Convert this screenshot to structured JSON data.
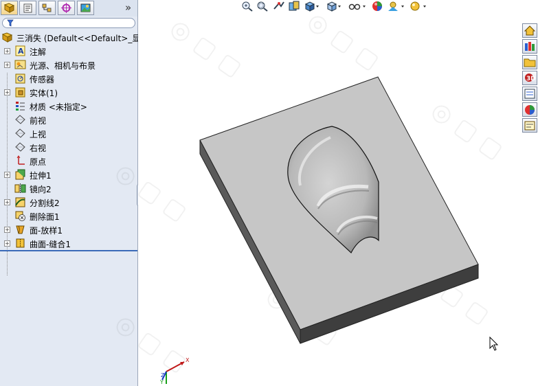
{
  "panel": {
    "tabs": [
      {
        "name": "featuremanager-tab"
      },
      {
        "name": "propertymanager-tab"
      },
      {
        "name": "configurationmanager-tab"
      },
      {
        "name": "dimxpert-tab"
      },
      {
        "name": "display-manager-tab"
      }
    ],
    "expand": "»",
    "tree": {
      "root": "三消失  (Default<<Default>_显",
      "items": [
        {
          "label": "注解",
          "icon": "annotations-icon",
          "expandable": true
        },
        {
          "label": "光源、相机与布景",
          "icon": "lights-camera-icon",
          "expandable": true
        },
        {
          "label": "传感器",
          "icon": "sensors-icon",
          "expandable": false
        },
        {
          "label": "实体(1)",
          "icon": "solid-bodies-icon",
          "expandable": true
        },
        {
          "label": "材质 <未指定>",
          "icon": "material-icon",
          "expandable": false
        },
        {
          "label": "前视",
          "icon": "plane-icon",
          "expandable": false
        },
        {
          "label": "上视",
          "icon": "plane-icon",
          "expandable": false
        },
        {
          "label": "右视",
          "icon": "plane-icon",
          "expandable": false
        },
        {
          "label": "原点",
          "icon": "origin-icon",
          "expandable": false
        },
        {
          "label": "拉伸1",
          "icon": "extrude-icon",
          "expandable": true
        },
        {
          "label": "镜向2",
          "icon": "mirror-icon",
          "expandable": false
        },
        {
          "label": "分割线2",
          "icon": "split-line-icon",
          "expandable": true
        },
        {
          "label": "删除面1",
          "icon": "delete-face-icon",
          "expandable": false
        },
        {
          "label": "面-放样1",
          "icon": "loft-surface-icon",
          "expandable": true
        },
        {
          "label": "曲面-缝合1",
          "icon": "knit-surface-icon",
          "expandable": true
        }
      ]
    }
  },
  "view_toolbar": [
    "zoom-to-fit-icon",
    "zoom-to-area-icon",
    "previous-view-icon",
    "section-view-icon",
    "view-orientation-icon",
    "display-style-icon",
    "hide-show-items-icon",
    "edit-appearance-icon",
    "apply-scene-icon",
    "view-settings-icon"
  ],
  "task_pane": [
    "resources-icon",
    "design-library-icon",
    "file-explorer-icon",
    "search-icon",
    "view-palette-icon",
    "appearances-icon",
    "custom-properties-icon"
  ],
  "triad": {
    "x": "X",
    "y": "Y",
    "z": "Z"
  },
  "colors": {
    "panel_bg": "#e3e9f3",
    "model_top": "#c6c6c6",
    "model_front": "#5a5a5a",
    "model_side": "#3e3e3e"
  }
}
